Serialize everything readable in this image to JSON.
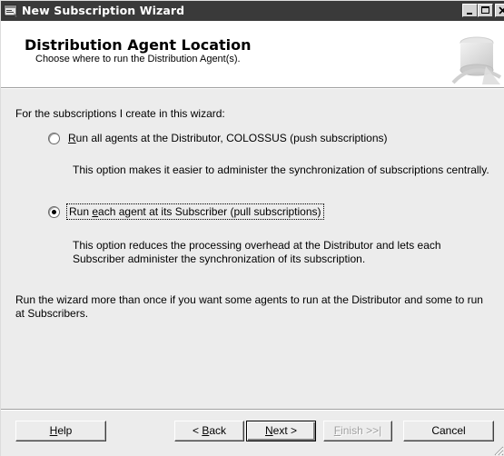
{
  "window": {
    "title": "New Subscription Wizard",
    "title_bar_color": "#3a3a3a",
    "icon": "wizard-window-icon",
    "controls": {
      "minimize_icon": "minimize-icon",
      "maximize_icon": "maximize-icon",
      "close_icon": "close-icon"
    }
  },
  "header": {
    "title": "Distribution Agent Location",
    "subtitle": "Choose where to run the Distribution Agent(s).",
    "graphic_icon": "wizard-banner-graphic"
  },
  "body": {
    "intro": "For the subscriptions I create in this wizard:",
    "options": [
      {
        "label_mnemonic": "R",
        "label_rest": "un all agents at the Distributor, COLOSSUS (push subscriptions)",
        "description": "This option makes it easier to administer the synchronization of subscriptions centrally.",
        "selected": false
      },
      {
        "label_start": "Run ",
        "label_mnemonic": "e",
        "label_rest": "ach agent at its Subscriber (pull subscriptions)",
        "description": "This option reduces the processing overhead at the Distributor and lets each Subscriber administer the synchronization of its subscription.",
        "selected": true
      }
    ],
    "note": "Run the wizard more than once if you want some agents to run at the Distributor and some to run at Subscribers."
  },
  "buttons": {
    "help": {
      "mnemonic": "H",
      "rest": "elp"
    },
    "back": {
      "prefix": "< ",
      "mnemonic": "B",
      "rest": "ack"
    },
    "next": {
      "mnemonic": "N",
      "rest": "ext >"
    },
    "finish": {
      "mnemonic": "F",
      "rest": "inish >>|",
      "enabled": false
    },
    "cancel": {
      "label": "Cancel"
    }
  }
}
